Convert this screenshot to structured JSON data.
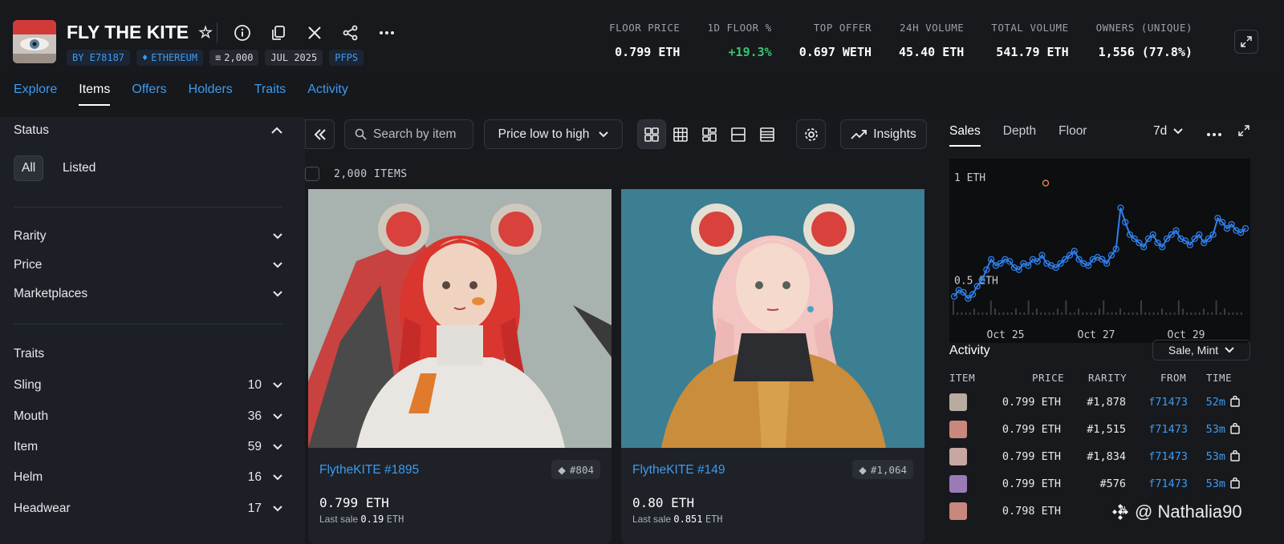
{
  "collection": {
    "name": "FLY THE KITE",
    "creator": "BY E78187",
    "chain": "ETHEREUM",
    "supply": "2,000",
    "date": "JUL 2025",
    "category": "PFPS"
  },
  "stats": [
    {
      "label": "FLOOR PRICE",
      "value": "0.799 ETH"
    },
    {
      "label": "1D FLOOR %",
      "value": "+19.3%",
      "color": "#3cc46e"
    },
    {
      "label": "TOP OFFER",
      "value": "0.697 WETH"
    },
    {
      "label": "24H VOLUME",
      "value": "45.40 ETH"
    },
    {
      "label": "TOTAL VOLUME",
      "value": "541.79 ETH"
    },
    {
      "label": "OWNERS (UNIQUE)",
      "value": "1,556 (77.8%)"
    }
  ],
  "nav_tabs": [
    "Explore",
    "Items",
    "Offers",
    "Holders",
    "Traits",
    "Activity"
  ],
  "active_tab": "Items",
  "sidebar": {
    "status_title": "Status",
    "status_options": [
      "All",
      "Listed"
    ],
    "filters": [
      "Rarity",
      "Price",
      "Marketplaces"
    ],
    "traits_title": "Traits",
    "traits": [
      {
        "name": "Sling",
        "count": "10"
      },
      {
        "name": "Mouth",
        "count": "36"
      },
      {
        "name": "Item",
        "count": "59"
      },
      {
        "name": "Helm",
        "count": "16"
      },
      {
        "name": "Headwear",
        "count": "17"
      }
    ]
  },
  "toolbar": {
    "search_placeholder": "Search by item",
    "sort": "Price low to high",
    "insights": "Insights"
  },
  "items_count": "2,000 ITEMS",
  "cards": [
    {
      "name": "FlytheKITE #1895",
      "rank": "#804",
      "price": "0.799",
      "currency": "ETH",
      "last_sale_label": "Last sale",
      "last_sale": "0.19",
      "last_sale_currency": "ETH"
    },
    {
      "name": "FlytheKITE #149",
      "rank": "#1,064",
      "price": "0.80",
      "currency": "ETH",
      "last_sale_label": "Last sale",
      "last_sale": "0.851",
      "last_sale_currency": "ETH"
    }
  ],
  "chart_tabs": [
    "Sales",
    "Depth",
    "Floor"
  ],
  "chart_range": "7d",
  "chart_data": {
    "type": "scatter",
    "y_ticks": [
      "1 ETH",
      "0.5 ETH"
    ],
    "x_ticks": [
      "Oct 25",
      "Oct 27",
      "Oct 29"
    ],
    "series": [
      {
        "values": [
          0.42,
          0.45,
          0.44,
          0.41,
          0.43,
          0.47,
          0.5,
          0.55,
          0.6,
          0.57,
          0.58,
          0.6,
          0.59,
          0.56,
          0.55,
          0.58,
          0.57,
          0.6,
          0.59,
          0.62,
          0.58,
          0.57,
          0.56,
          0.58,
          0.6,
          0.62,
          0.64,
          0.6,
          0.58,
          0.57,
          0.6,
          0.61,
          0.6,
          0.58,
          0.62,
          0.65,
          0.85,
          0.78,
          0.72,
          0.7,
          0.68,
          0.66,
          0.7,
          0.72,
          0.68,
          0.66,
          0.7,
          0.72,
          0.74,
          0.7,
          0.69,
          0.67,
          0.7,
          0.72,
          0.68,
          0.7,
          0.72,
          0.8,
          0.78,
          0.75,
          0.77,
          0.74,
          0.73,
          0.75
        ],
        "color": "#2f80ed"
      },
      {
        "values": [
          0.97
        ],
        "color": "#f08c5a"
      }
    ]
  },
  "activity": {
    "title": "Activity",
    "filter": "Sale, Mint",
    "headers": [
      "ITEM",
      "PRICE",
      "RARITY",
      "FROM",
      "TIME"
    ],
    "rows": [
      {
        "price": "0.799 ETH",
        "rarity": "#1,878",
        "from": "f71473",
        "time": "52m"
      },
      {
        "price": "0.799 ETH",
        "rarity": "#1,515",
        "from": "f71473",
        "time": "53m"
      },
      {
        "price": "0.799 ETH",
        "rarity": "#1,834",
        "from": "f71473",
        "time": "53m"
      },
      {
        "price": "0.799 ETH",
        "rarity": "#576",
        "from": "f71473",
        "time": "53m"
      },
      {
        "price": "0.798 ETH",
        "rarity": "#",
        "from": "",
        "time": ""
      }
    ]
  },
  "watermark": "@ Nathalia90"
}
